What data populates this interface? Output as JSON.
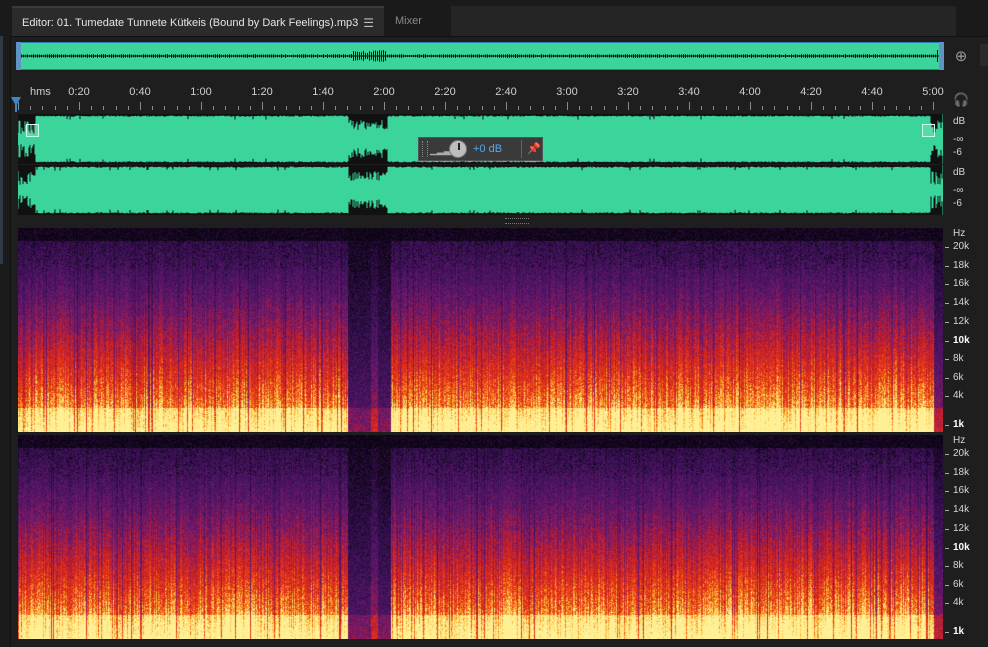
{
  "tabs": {
    "editor_title": "Editor: 01. Tumedate Tunnete Kütkeis (Bound by Dark Feelings).mp3",
    "editor_menu_icon": "hamburger-icon",
    "mixer_label": "Mixer"
  },
  "toolbar": {
    "zoom_icon": "zoom-target-icon",
    "headphones_icon": "headphones-icon"
  },
  "ruler": {
    "unit": "hms",
    "labels": [
      "0:20",
      "0:40",
      "1:00",
      "1:20",
      "1:40",
      "2:00",
      "2:20",
      "2:40",
      "3:00",
      "3:20",
      "3:40",
      "4:00",
      "4:20",
      "4:40",
      "5:00"
    ]
  },
  "waveform": {
    "channels": [
      {
        "db_unit": "dB",
        "db_levels": [
          "-∞",
          "-6"
        ]
      },
      {
        "db_unit": "dB",
        "db_levels": [
          "-∞",
          "-6"
        ]
      }
    ],
    "color": "#3bd49b"
  },
  "hud": {
    "gain_value": "+0 dB",
    "pin_icon": "pin-icon",
    "level_icon": "level-bars-icon"
  },
  "spectral": {
    "hz_unit": "Hz",
    "hz_labels": [
      "20k",
      "18k",
      "16k",
      "14k",
      "12k",
      "10k",
      "8k",
      "6k",
      "4k",
      "1k"
    ],
    "major_labels": [
      "10k",
      "1k"
    ]
  },
  "colors": {
    "accent": "#3a87c9",
    "waveform": "#3bd49b",
    "background": "#1e1e1e"
  }
}
